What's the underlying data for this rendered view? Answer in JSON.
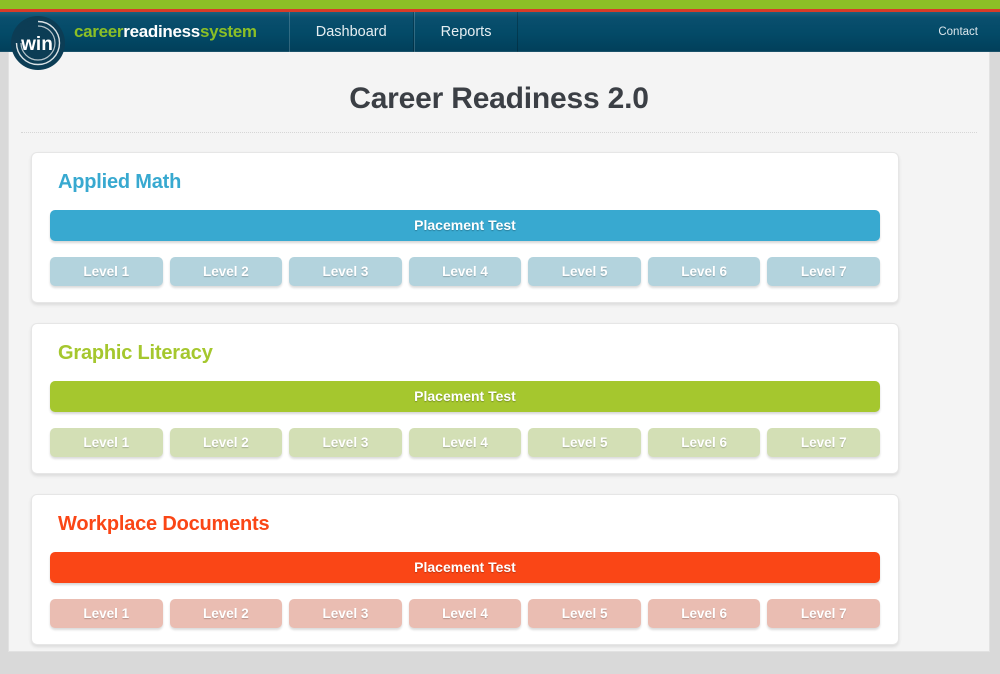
{
  "header": {
    "logo_text": "win",
    "brand": {
      "part1": "career",
      "part2": "readiness",
      "part3": "system"
    },
    "nav_items": [
      {
        "label": "Dashboard"
      },
      {
        "label": "Reports"
      }
    ],
    "contact_label": "Contact",
    "colors": {
      "stripe_green": "#8cbf26",
      "stripe_red": "#d93b28",
      "navy": "#034a67"
    }
  },
  "main": {
    "title": "Career Readiness 2.0",
    "placement_label": "Placement Test",
    "subjects": [
      {
        "name": "Applied Math",
        "accent_color": "#38a9d0",
        "level_color": "#b3d3dd",
        "placement_label": "Placement Test",
        "levels": [
          "Level 1",
          "Level 2",
          "Level 3",
          "Level 4",
          "Level 5",
          "Level 6",
          "Level 7"
        ]
      },
      {
        "name": "Graphic Literacy",
        "accent_color": "#a5c72e",
        "level_color": "#d3dfb5",
        "placement_label": "Placement Test",
        "levels": [
          "Level 1",
          "Level 2",
          "Level 3",
          "Level 4",
          "Level 5",
          "Level 6",
          "Level 7"
        ]
      },
      {
        "name": "Workplace Documents",
        "accent_color": "#fa4616",
        "level_color": "#eabdb2",
        "placement_label": "Placement Test",
        "levels": [
          "Level 1",
          "Level 2",
          "Level 3",
          "Level 4",
          "Level 5",
          "Level 6",
          "Level 7"
        ]
      }
    ]
  }
}
